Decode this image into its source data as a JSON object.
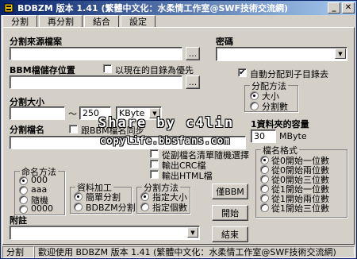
{
  "window": {
    "title": "BDBZM 版本 1.41 (繁體中文化：水柔情工作室@SWF技術交流網)"
  },
  "tabs": [
    "分割",
    "再分割",
    "結合",
    "設定"
  ],
  "source": {
    "label": "分割來源檔案",
    "value": "",
    "browse": "..."
  },
  "password": {
    "label": "密碼",
    "value": ""
  },
  "bbm_location": {
    "label": "BBM檔儲存位置",
    "same_dir_label": "以現在的目錄為優先",
    "value": "",
    "browse": "..."
  },
  "auto_subdir": {
    "label": "自動分配到子目錄去",
    "checked": "✔"
  },
  "split_size": {
    "label": "分割大小",
    "from": "",
    "tilde": "～",
    "to": "250",
    "unit": "KByte"
  },
  "distribution": {
    "title": "分配方法",
    "options": [
      "大小",
      "分割數"
    ],
    "selected": 0
  },
  "split_name": {
    "label": "分割檔名",
    "same_bbm_label": "跟BBM檔名同步",
    "value": ""
  },
  "folder_capacity": {
    "label": "1資料夾的容量",
    "value": "30",
    "unit": "MByte"
  },
  "options": {
    "random_select": "從副檔名清單隨機選擇",
    "output_crc": "輸出CRC檔",
    "output_html": "輸出HTML檔"
  },
  "naming": {
    "title": "命名方法",
    "options": [
      "000",
      "aaa",
      "隨機",
      "0000"
    ],
    "selected": 0
  },
  "data_process": {
    "title": "資料加工",
    "options": [
      "簡單分割",
      "BDBZM分割"
    ],
    "selected": 0
  },
  "split_method": {
    "title": "分割方法",
    "options": [
      "指定大小",
      "指定個數"
    ],
    "selected": 0
  },
  "name_format": {
    "title": "檔名格式",
    "options": [
      "從0開始一位數",
      "從0開始兩位數",
      "從0開始三位數",
      "從1開始一位數",
      "從1開始兩位數",
      "從1開始三位數"
    ],
    "selected": 0
  },
  "buttons": {
    "make_bbm": "僅BBM",
    "start": "開始",
    "close": "結束"
  },
  "note": {
    "label": "附註",
    "value": ""
  },
  "status": {
    "mode": "分割",
    "message": "歡迎使用 BDBZM 版本 1.41 (繁體中文化：水柔情工作室@SWF技術交流網)"
  },
  "watermark": {
    "line1": "Share by c4lin",
    "line2": "copylife.bbsfans.com"
  }
}
